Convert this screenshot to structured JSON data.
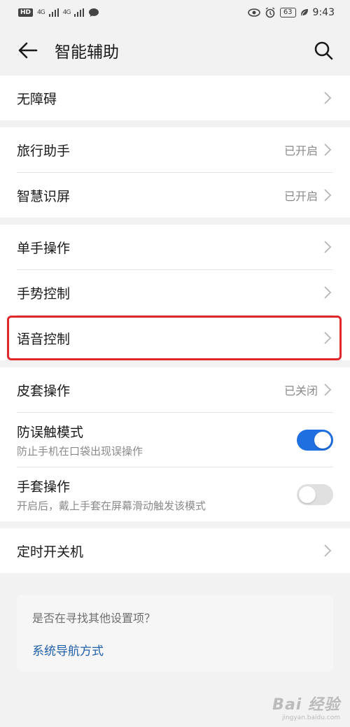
{
  "status_bar": {
    "left_badge": "HD",
    "signal1": "4G",
    "signal2": "4G",
    "battery": "63",
    "time": "9:43"
  },
  "header": {
    "title": "智能辅助"
  },
  "groups": [
    {
      "rows": [
        {
          "label": "无障碍",
          "status": ""
        }
      ]
    },
    {
      "rows": [
        {
          "label": "旅行助手",
          "status": "已开启"
        },
        {
          "label": "智慧识屏",
          "status": "已开启"
        }
      ]
    },
    {
      "rows": [
        {
          "label": "单手操作",
          "status": ""
        },
        {
          "label": "手势控制",
          "status": ""
        },
        {
          "label": "语音控制",
          "status": ""
        }
      ]
    },
    {
      "rows": [
        {
          "label": "皮套操作",
          "status": "已关闭"
        },
        {
          "label": "防误触模式",
          "sub": "防止手机在口袋出现误操作",
          "toggle": "on"
        },
        {
          "label": "手套操作",
          "sub": "开启后，戴上手套在屏幕滑动触发该模式",
          "toggle": "off"
        }
      ]
    },
    {
      "rows": [
        {
          "label": "定时开关机",
          "status": ""
        }
      ]
    }
  ],
  "suggest": {
    "question": "是否在寻找其他设置项？",
    "link": "系统导航方式"
  },
  "watermark": {
    "main": "Bai 经验",
    "sub": "jingyan.baidu.com"
  },
  "colors": {
    "toggle_on": "#1f6fe0",
    "highlight": "#e0282c",
    "link": "#1e5fa8"
  }
}
